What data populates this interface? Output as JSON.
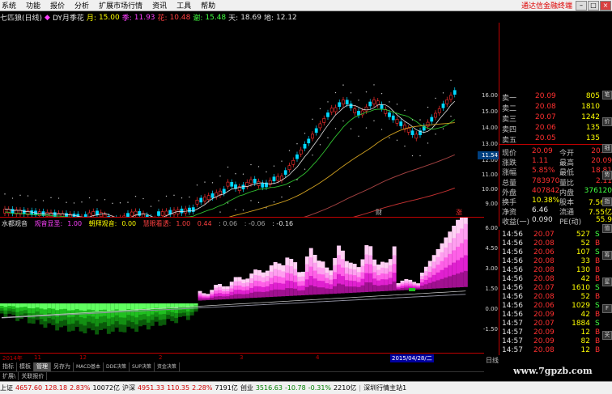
{
  "menu": {
    "items": [
      "系统",
      "功能",
      "报价",
      "分析",
      "扩展市场行情",
      "资讯",
      "工具",
      "帮助"
    ],
    "broker": "通达信金融终端"
  },
  "quote_line": {
    "name": "七匹狼(日线)",
    "indicator": "DY月季花",
    "month_label": "月:",
    "month_value": "15.00",
    "ji_label": "季:",
    "ji_value": "11.93",
    "hua_label": "花:",
    "hua_value": "10.48",
    "xie_label": "谢:",
    "xie_value": "15.48",
    "tian_label": "天:",
    "tian_value": "18.69",
    "di_label": "地:",
    "di_value": "12.12"
  },
  "price_axis": [
    "16.00",
    "15.00",
    "14.00",
    "13.00",
    "12.00",
    "11.00",
    "10.00",
    "9.00"
  ],
  "current_price_tag": "11.54",
  "indicator_panel": {
    "title": "水都观音",
    "label1": "观音显圣:",
    "value1": "1.00",
    "label2": "朝拜观音:",
    "value2": "0.00",
    "label3": "慧眼看透:",
    "value3": "1.00",
    "value4": "0.44",
    "value5": ": 0.06",
    "value6": ": -0.06",
    "value7": ": -0.16",
    "axis": [
      "6.00",
      "4.50",
      "3.00",
      "1.50",
      "0.00",
      "-1.50"
    ]
  },
  "time_axis": [
    "2014年",
    "11",
    "12",
    "2",
    "3",
    "4"
  ],
  "time_cursor": "2015/04/28/二",
  "markers": [
    "财",
    "涨"
  ],
  "order_book": {
    "asks": [
      {
        "label": "卖一",
        "price": "20.09",
        "vol": "805"
      },
      {
        "label": "卖二",
        "price": "20.08",
        "vol": "1810"
      },
      {
        "label": "卖三",
        "price": "20.07",
        "vol": "1242"
      },
      {
        "label": "卖四",
        "price": "20.06",
        "vol": "135"
      },
      {
        "label": "卖五",
        "price": "20.05",
        "vol": "135"
      }
    ]
  },
  "stats": [
    {
      "l1": "现价",
      "v1": "20.09",
      "l2": "今开",
      "v2": "20.05"
    },
    {
      "l1": "涨跌",
      "v1": "1.11",
      "l2": "最高",
      "v2": "20.09"
    },
    {
      "l1": "涨幅",
      "v1": "5.85%",
      "l2": "最低",
      "v2": "18.81"
    },
    {
      "l1": "总量",
      "v1": "783970",
      "l2": "量比",
      "v2": "2.11"
    },
    {
      "l1": "外盘",
      "v1": "407842",
      "l2": "内盘",
      "v2": "376120"
    },
    {
      "l1": "换手",
      "v1": "10.38%",
      "l2": "股本",
      "v2": "7.56亿"
    },
    {
      "l1": "净资",
      "v1": "6.46",
      "l2": "流通",
      "v2": "7.55亿"
    },
    {
      "l1": "收益(一)",
      "v1": "0.090",
      "l2": "PE(动)",
      "v2": "55.9"
    }
  ],
  "trades": [
    {
      "time": "14:56",
      "price": "20.07",
      "vol": "527",
      "side": "S"
    },
    {
      "time": "14:56",
      "price": "20.08",
      "vol": "52",
      "side": "B"
    },
    {
      "time": "14:56",
      "price": "20.06",
      "vol": "107",
      "side": "S"
    },
    {
      "time": "14:56",
      "price": "20.08",
      "vol": "33",
      "side": "B"
    },
    {
      "time": "14:56",
      "price": "20.08",
      "vol": "130",
      "side": "B"
    },
    {
      "time": "14:56",
      "price": "20.08",
      "vol": "42",
      "side": "B"
    },
    {
      "time": "14:56",
      "price": "20.07",
      "vol": "1610",
      "side": "S"
    },
    {
      "time": "14:56",
      "price": "20.08",
      "vol": "52",
      "side": "B"
    },
    {
      "time": "14:56",
      "price": "20.06",
      "vol": "1029",
      "side": "S"
    },
    {
      "time": "14:56",
      "price": "20.09",
      "vol": "42",
      "side": "B"
    },
    {
      "time": "14:57",
      "price": "20.07",
      "vol": "1884",
      "side": "S"
    },
    {
      "time": "14:57",
      "price": "20.09",
      "vol": "12",
      "side": "B"
    },
    {
      "time": "14:57",
      "price": "20.09",
      "vol": "82",
      "side": "B"
    },
    {
      "time": "14:57",
      "price": "20.08",
      "vol": "12",
      "side": "B"
    }
  ],
  "side_tabs": [
    "笔",
    "价",
    "细",
    "势",
    "指",
    "值",
    "筹",
    "星",
    "F",
    "关"
  ],
  "tabs": [
    "指标",
    "模板",
    "管理",
    "另存为",
    "MACD基本",
    "DDE决策",
    "SUP决策",
    "资金决策"
  ],
  "sub_tabs": [
    "扩展\\",
    "关联报价"
  ],
  "bottom_right": {
    "label": "日线",
    "watermark": "www.7gpzb.com"
  },
  "status": {
    "sh_label": "上证",
    "sh_value": "4657.60",
    "sh_change": "128.18",
    "sh_pct": "2.83%",
    "sh_amount": "10072亿",
    "sz_label": "沪深",
    "sz_value": "4951.33",
    "sz_change": "110.35",
    "sz_pct": "2.28%",
    "sz_amount": "7191亿",
    "cy_label": "创业",
    "cy_value": "3516.63",
    "cy_change": "-10.78",
    "cy_pct": "-0.31%",
    "cy_amount": "2210亿",
    "site": "深圳行情主站1"
  },
  "colors": {
    "up": "#ff3030",
    "down": "#00d8ff",
    "ma_white": "#e0e0e0",
    "ma_green": "#30c030",
    "ma_yellow": "#d0a020",
    "ma_brown": "#a04040",
    "pink": "#ff66ee",
    "green": "#20c020"
  }
}
